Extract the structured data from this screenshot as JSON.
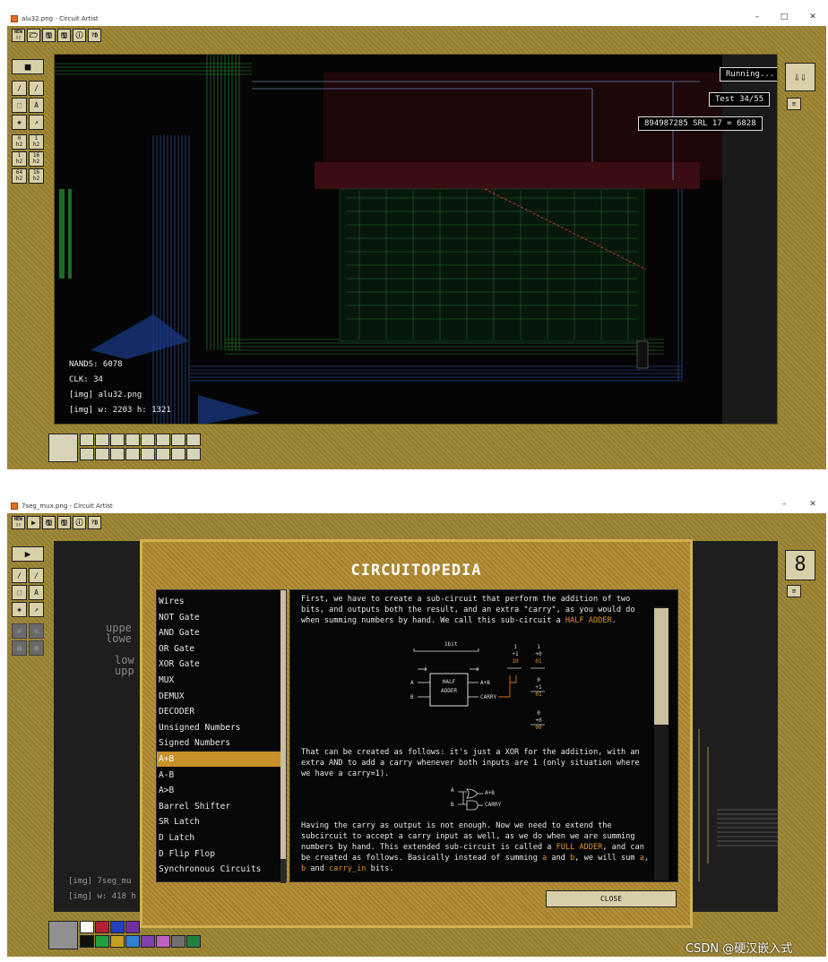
{
  "window1": {
    "title": "alu32.png - Circuit Artist",
    "toolbar_glyphs": [
      "NEW",
      "open",
      "save",
      "save-as",
      "i",
      "?"
    ],
    "tool_glyphs": [
      "■",
      "∕",
      "∕",
      "⬚",
      "A",
      "⬚",
      "↗",
      "0",
      "1",
      "1",
      "16",
      "64",
      "16"
    ],
    "hud": {
      "running": "Running...",
      "test": "Test 34/55",
      "calc": "894987285 SRL 17 = 6828"
    },
    "stats": {
      "nands": "NANDS: 6078",
      "clk": "CLK: 34",
      "img": "[img] alu32.png",
      "dims": "[img] w: 2203 h: 1321"
    }
  },
  "window2": {
    "title": "7seg_mux.png - Circuit Artist",
    "toolbar_glyphs": [
      "NEW",
      "▶",
      "save",
      "save-as",
      "i",
      "?"
    ],
    "tool_glyphs": [
      "▶",
      "∕",
      "∕",
      "⬚",
      "A",
      "⬚",
      "↗"
    ],
    "seven_seg_digit": "8",
    "bg_text": [
      "uppe",
      "lowe",
      "low",
      "upp"
    ],
    "stats": {
      "img": "[img] 7seg_mu",
      "dims": "[img] w: 418 h"
    },
    "dialog": {
      "title": "CIRCUITOPEDIA",
      "close_label": "CLOSE",
      "selected_index": 10,
      "topics": [
        "Wires",
        "NOT Gate",
        "AND Gate",
        "OR Gate",
        "XOR Gate",
        "MUX",
        "DEMUX",
        "DECODER",
        "Unsigned Numbers",
        "Signed Numbers",
        "A+B",
        "A-B",
        "A>B",
        "Barrel Shifter",
        "SR Latch",
        "D Latch",
        "D Flip Flop",
        "Synchronous Circuits"
      ],
      "para1_a": "First, we have to create a sub-circuit that perform the addition of two bits, and outputs both the result, and an extra \"carry\", as you would do when summing numbers by hand. We call this sub-circuit a ",
      "para1_hl": "HALF ADDER",
      "para1_b": ".",
      "para2": "That can be created as follows: it's just a XOR for the addition, with an extra AND to add a carry whenever both inputs are 1 (only situation where we have a carry=1).",
      "para3_a": "Having the carry as output is not enough. Now we need to extend the subcircuit to accept a carry input as well, as we do when we are summing numbers by hand. This extended sub-circuit is called a ",
      "para3_hl1": "FULL ADDER",
      "para3_b": ", and can be created as follows. Basically instead of summing ",
      "para3_hl2": "a",
      "para3_c": " and ",
      "para3_hl3": "b",
      "para3_d": ", we will sum ",
      "para3_hl4": "a",
      "para3_e": ", ",
      "para3_hl5": "b",
      "para3_f": " and ",
      "para3_hl6": "carry_in",
      "para3_g": " bits.",
      "diagram": {
        "bit_label": "1bit",
        "box_l1": "HALF",
        "box_l2": "ADDER",
        "in_a": "A",
        "in_b": "B",
        "out_sum": "A+B",
        "out_carry": "CARRY",
        "sums": [
          {
            "top": "1",
            "add": "+1",
            "res": "10"
          },
          {
            "top": "1",
            "add": "+0",
            "res": "01"
          },
          {
            "top": "0",
            "add": "+1",
            "res": "01"
          },
          {
            "top": "0",
            "add": "+0",
            "res": "00"
          }
        ],
        "xor_in_a": "A",
        "xor_in_b": "B",
        "xor_out": "A+B",
        "and_out": "CARRY"
      }
    }
  },
  "watermark": "CSDN @硬汉嵌入式"
}
